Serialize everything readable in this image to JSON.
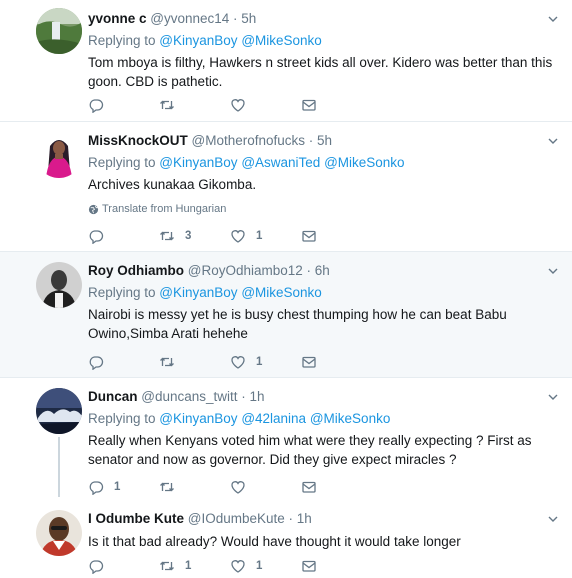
{
  "tweets": [
    {
      "name": "yvonne c",
      "meta": "@yvonnec14 · 5h",
      "replying_prefix": "Replying to ",
      "mentions": [
        "@KinyanBoy",
        "@MikeSonko"
      ],
      "text": "Tom mboya is filthy, Hawkers n street kids all over. Kidero was better than this goon. CBD is pathetic.",
      "replies": "",
      "retweets": "",
      "likes": ""
    },
    {
      "name": "MissKnockOUT",
      "meta": "@Motherofnofucks · 5h",
      "replying_prefix": "Replying to ",
      "mentions": [
        "@KinyanBoy",
        "@AswaniTed",
        "@MikeSonko"
      ],
      "text": "Archives kunakaa Gikomba.",
      "translate": "Translate from Hungarian",
      "replies": "",
      "retweets": "3",
      "likes": "1"
    },
    {
      "name": "Roy Odhiambo",
      "meta": "@RoyOdhiambo12 · 6h",
      "replying_prefix": "Replying to ",
      "mentions": [
        "@KinyanBoy",
        "@MikeSonko"
      ],
      "text": "Nairobi is messy yet he is busy chest thumping how he can beat Babu Owino,Simba Arati hehehe",
      "replies": "",
      "retweets": "",
      "likes": "1"
    },
    {
      "name": "Duncan",
      "meta": "@duncans_twitt · 1h",
      "replying_prefix": "Replying to ",
      "mentions": [
        "@KinyanBoy",
        "@42lanina",
        "@MikeSonko"
      ],
      "text": "Really when Kenyans voted him what were they really expecting ? First as senator and now as governor. Did they give expect miracles ?",
      "replies": "1",
      "retweets": "",
      "likes": ""
    },
    {
      "name": "I Odumbe Kute",
      "meta": "@IOdumbeKute · 1h",
      "text": "Is it that bad already? Would have thought it would take longer",
      "replies": "",
      "retweets": "1",
      "likes": "1"
    }
  ]
}
